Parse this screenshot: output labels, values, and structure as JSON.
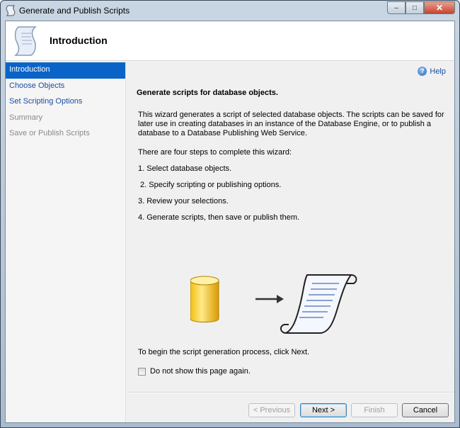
{
  "window": {
    "title": "Generate and Publish Scripts",
    "minimize": "–",
    "maximize": "□",
    "close": "✕"
  },
  "header": {
    "title": "Introduction"
  },
  "sidebar": {
    "items": [
      {
        "label": "Introduction",
        "state": "active"
      },
      {
        "label": "Choose Objects",
        "state": "link"
      },
      {
        "label": "Set Scripting Options",
        "state": "link"
      },
      {
        "label": "Summary",
        "state": "disabled"
      },
      {
        "label": "Save or Publish Scripts",
        "state": "disabled"
      }
    ]
  },
  "main": {
    "help_label": "Help",
    "help_glyph": "?",
    "heading": "Generate scripts for database objects.",
    "description": "This wizard generates a script of selected database objects. The scripts can be saved for later use in creating databases in an instance of the Database Engine, or to publish a database to a Database Publishing Web Service.",
    "steps_intro": "There are four steps to complete this wizard:",
    "steps": [
      "1. Select database objects.",
      " 2. Specify scripting or publishing options.",
      "3. Review your selections.",
      "4. Generate scripts, then save or publish them."
    ],
    "begin_text": "To begin the script generation process, click Next.",
    "checkbox_label": "Do not show this page again.",
    "checkbox_checked": false
  },
  "buttons": {
    "previous": "< Previous",
    "next": "Next >",
    "finish": "Finish",
    "cancel": "Cancel"
  }
}
